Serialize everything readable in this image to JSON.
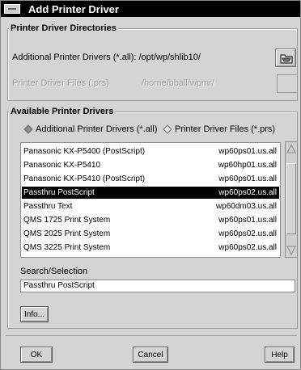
{
  "window": {
    "title": "Add Printer Driver"
  },
  "directories": {
    "legend": "Printer Driver Directories",
    "additional_label": "Additional Printer Drivers (*.all): /opt/wp/shlib10/",
    "additional_icon": "folder-open-icon",
    "files_label": "Printer Driver Files (.prs)",
    "files_path": "/home/bball/wpmr/"
  },
  "available": {
    "legend": "Available Printer Drivers",
    "radio_all": "Additional Printer Drivers (*.all)",
    "radio_prs": "Printer Driver Files (*.prs)",
    "selected_radio": "all",
    "rows": [
      {
        "name": "Panasonic KX-P5400 (PostScript)",
        "file": "wp60ps01.us.all"
      },
      {
        "name": "Panasonic KX-P5410",
        "file": "wp60hp01.us.all"
      },
      {
        "name": "Panasonic KX-P5410 (PostScript)",
        "file": "wp60ps01.us.all"
      },
      {
        "name": "Passthru PostScript",
        "file": "wp60ps02.us.all"
      },
      {
        "name": "Passthru Text",
        "file": "wp60dm03.us.all"
      },
      {
        "name": "QMS 1725 Print System",
        "file": "wp60ps01.us.all"
      },
      {
        "name": "QMS 2025 Print System",
        "file": "wp60ps02.us.all"
      },
      {
        "name": "QMS 3225 Print System",
        "file": "wp60ps02.us.all"
      }
    ],
    "selected_index": 3,
    "search_label": "Search/Selection",
    "search_value": "Passthru PostScript",
    "info_button": "Info..."
  },
  "buttons": {
    "ok": "OK",
    "cancel": "Cancel",
    "help": "Help"
  },
  "colors": {
    "selection": "#000000",
    "title_bar": "#000000",
    "dialog_bg": "#d4d4d4"
  }
}
